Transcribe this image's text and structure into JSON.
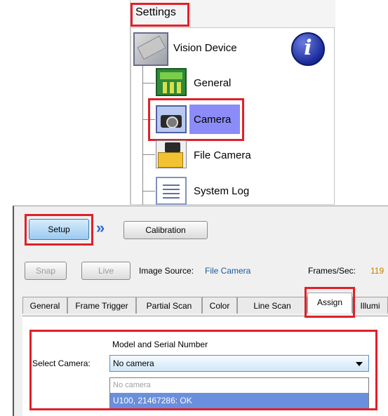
{
  "settings_tree": {
    "tab_label": "Settings",
    "root": {
      "label": "Vision Device",
      "icon": "vision-device-icon"
    },
    "info_icon": "info-icon",
    "info_glyph": "i",
    "items": [
      {
        "label": "General",
        "icon": "general-settings-icon"
      },
      {
        "label": "Camera",
        "icon": "camera-icon",
        "selected": true
      },
      {
        "label": "File Camera",
        "icon": "file-camera-icon"
      },
      {
        "label": "System Log",
        "icon": "system-log-icon"
      }
    ],
    "selection_color": "#8c8cf8"
  },
  "toolbar": {
    "setup_label": "Setup",
    "chevron_icon": "double-chevron-right-icon",
    "chevron_glyph": "»",
    "calibration_label": "Calibration"
  },
  "acquisition": {
    "snap_label": "Snap",
    "live_label": "Live",
    "image_source_label": "Image Source:",
    "image_source_value": "File Camera",
    "frames_label": "Frames/Sec:",
    "frames_value": "119"
  },
  "tabs": [
    {
      "label": "General"
    },
    {
      "label": "Frame Trigger"
    },
    {
      "label": "Partial Scan"
    },
    {
      "label": "Color"
    },
    {
      "label": "Line Scan"
    },
    {
      "label": "Assign",
      "active": true
    },
    {
      "label": "Illumi"
    }
  ],
  "assign": {
    "column_header": "Model and Serial Number",
    "select_label": "Select Camera:",
    "selected_value": "No camera",
    "options": [
      "No camera",
      "U100, 21467286: OK"
    ],
    "highlighted_option": "U100, 21467286: OK"
  },
  "colors": {
    "highlight_box": "#e0202a",
    "setup_button": "#9ccaf0",
    "list_highlight": "#6a8fdc"
  }
}
